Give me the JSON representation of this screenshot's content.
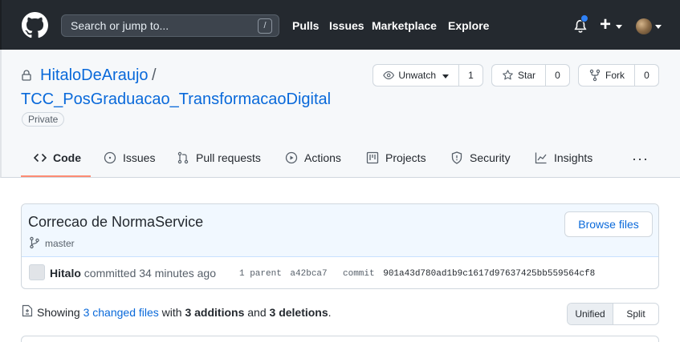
{
  "header": {
    "search_placeholder": "Search or jump to...",
    "search_shortcut": "/",
    "nav": [
      "Pulls",
      "Issues",
      "Marketplace",
      "Explore"
    ]
  },
  "repo": {
    "owner": "HitaloDeAraujo",
    "separator": "/",
    "name": "TCC_PosGraduacao_TransformacaoDigital",
    "visibility": "Private",
    "watch": {
      "label": "Unwatch",
      "count": "1"
    },
    "star": {
      "label": "Star",
      "count": "0"
    },
    "fork": {
      "label": "Fork",
      "count": "0"
    }
  },
  "tabs": [
    "Code",
    "Issues",
    "Pull requests",
    "Actions",
    "Projects",
    "Security",
    "Insights"
  ],
  "more": "···",
  "commit": {
    "title": "Correcao de NormaService",
    "branch": "master",
    "browse_label": "Browse files",
    "author": "Hitalo",
    "committed_text": "committed 34 minutes ago",
    "parent_label": "1 parent",
    "parent_sha": "a42bca7",
    "commit_label": "commit",
    "commit_sha": "901a43d780ad1b9c1617d97637425bb559564cf8"
  },
  "diff": {
    "showing": "Showing",
    "files_changed": "3 changed files",
    "with": "with",
    "additions": "3 additions",
    "and": "and",
    "deletions": "3 deletions",
    "period": ".",
    "unified_label": "Unified",
    "split_label": "Split"
  },
  "colors": {
    "header_bg": "#24292f",
    "link": "#0969da",
    "tab_underline": "#fd8c73",
    "commit_bg": "#f1f8ff"
  }
}
